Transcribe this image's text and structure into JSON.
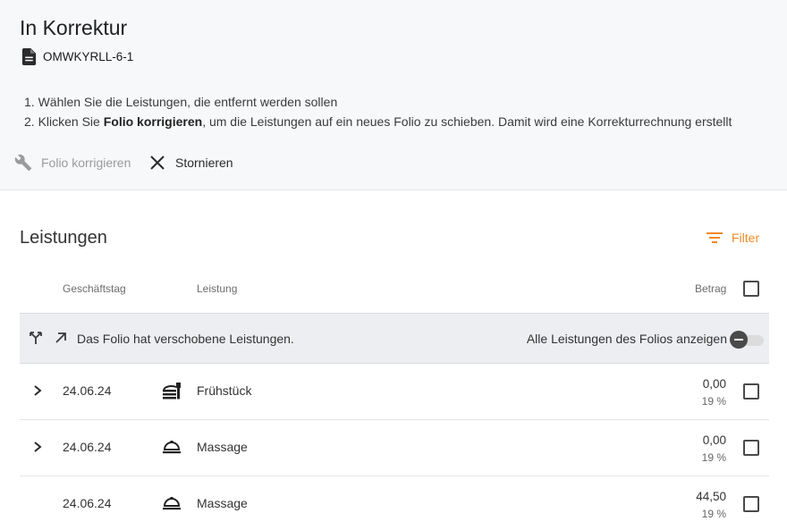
{
  "header": {
    "title": "In Korrektur",
    "folio_id": "OMWKYRLL-6-1",
    "step1": "1. Wählen Sie die Leistungen, die entfernt werden sollen",
    "step2_prefix": "2. Klicken Sie ",
    "step2_bold": "Folio korrigieren",
    "step2_suffix": ", um die Leistungen auf ein neues Folio zu schieben. Damit wird eine Korrekturrechnung erstellt"
  },
  "actions": {
    "correct_label": "Folio korrigieren",
    "correct_icon": "wrench-icon",
    "cancel_label": "Stornieren",
    "cancel_icon": "close-icon"
  },
  "section": {
    "title": "Leistungen",
    "filter_label": "Filter",
    "filter_icon": "filter-icon",
    "accent_color": "#f08a24"
  },
  "columns": {
    "date": "Geschäftstag",
    "service": "Leistung",
    "amount": "Betrag"
  },
  "banner": {
    "message": "Das Folio hat verschobene Leistungen.",
    "toggle_label": "Alle Leistungen des Folios anzeigen",
    "toggle_on": false
  },
  "rows": [
    {
      "date": "24.06.24",
      "service": "Frühstück",
      "icon": "breakfast-icon",
      "amount": "0,00",
      "tax": "19 %",
      "expandable": true
    },
    {
      "date": "24.06.24",
      "service": "Massage",
      "icon": "service-bell-icon",
      "amount": "0,00",
      "tax": "19 %",
      "expandable": true
    },
    {
      "date": "24.06.24",
      "service": "Massage",
      "icon": "service-bell-icon",
      "amount": "44,50",
      "tax": "19 %",
      "expandable": false
    }
  ]
}
